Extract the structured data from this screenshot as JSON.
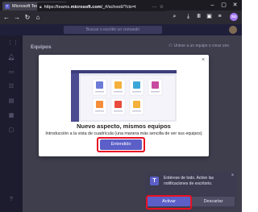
{
  "browser": {
    "tab_title": "Microsoft Teams",
    "tab_close": "×",
    "new_tab": "+",
    "url_prefix": "https://teams.",
    "url_domain": "microsoft.com",
    "url_rest": "/_#/school//?ctx=t",
    "more_icon": "···",
    "profile_initials": "SU",
    "minimize": "–",
    "maximize": "▢",
    "close": "✕"
  },
  "teams": {
    "search_placeholder": "Buscar o escribir un comando",
    "page_title": "Equipos",
    "join_label": "Unirse a un equipo o crear uno"
  },
  "modal": {
    "heading": "Nuevo aspecto, mismos equipos",
    "description": "Introducción a la vista de cuadrícula (una manera más sencilla de ver sus equipos)",
    "button_label": "Entendido",
    "close_icon": "×"
  },
  "notification": {
    "message": "Entérese de todo. Active las notificaciones de escritorio.",
    "activate_label": "Activar",
    "dismiss_label": "Descartar",
    "close_icon": "×",
    "logo_letter": "T"
  },
  "colors": {
    "teams_purple": "#5b5fc7",
    "highlight_red": "#e81123",
    "browser_dark": "#1c1b22"
  }
}
